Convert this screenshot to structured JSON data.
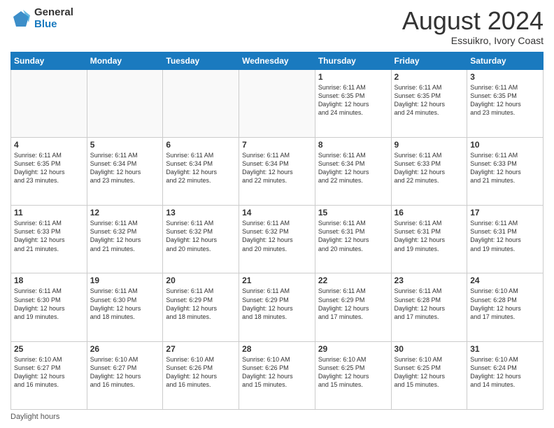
{
  "logo": {
    "general": "General",
    "blue": "Blue"
  },
  "header": {
    "month": "August 2024",
    "location": "Essuikro, Ivory Coast"
  },
  "days_of_week": [
    "Sunday",
    "Monday",
    "Tuesday",
    "Wednesday",
    "Thursday",
    "Friday",
    "Saturday"
  ],
  "footer": {
    "label": "Daylight hours"
  },
  "weeks": [
    [
      {
        "day": "",
        "info": ""
      },
      {
        "day": "",
        "info": ""
      },
      {
        "day": "",
        "info": ""
      },
      {
        "day": "",
        "info": ""
      },
      {
        "day": "1",
        "info": "Sunrise: 6:11 AM\nSunset: 6:35 PM\nDaylight: 12 hours\nand 24 minutes."
      },
      {
        "day": "2",
        "info": "Sunrise: 6:11 AM\nSunset: 6:35 PM\nDaylight: 12 hours\nand 24 minutes."
      },
      {
        "day": "3",
        "info": "Sunrise: 6:11 AM\nSunset: 6:35 PM\nDaylight: 12 hours\nand 23 minutes."
      }
    ],
    [
      {
        "day": "4",
        "info": "Sunrise: 6:11 AM\nSunset: 6:35 PM\nDaylight: 12 hours\nand 23 minutes."
      },
      {
        "day": "5",
        "info": "Sunrise: 6:11 AM\nSunset: 6:34 PM\nDaylight: 12 hours\nand 23 minutes."
      },
      {
        "day": "6",
        "info": "Sunrise: 6:11 AM\nSunset: 6:34 PM\nDaylight: 12 hours\nand 22 minutes."
      },
      {
        "day": "7",
        "info": "Sunrise: 6:11 AM\nSunset: 6:34 PM\nDaylight: 12 hours\nand 22 minutes."
      },
      {
        "day": "8",
        "info": "Sunrise: 6:11 AM\nSunset: 6:34 PM\nDaylight: 12 hours\nand 22 minutes."
      },
      {
        "day": "9",
        "info": "Sunrise: 6:11 AM\nSunset: 6:33 PM\nDaylight: 12 hours\nand 22 minutes."
      },
      {
        "day": "10",
        "info": "Sunrise: 6:11 AM\nSunset: 6:33 PM\nDaylight: 12 hours\nand 21 minutes."
      }
    ],
    [
      {
        "day": "11",
        "info": "Sunrise: 6:11 AM\nSunset: 6:33 PM\nDaylight: 12 hours\nand 21 minutes."
      },
      {
        "day": "12",
        "info": "Sunrise: 6:11 AM\nSunset: 6:32 PM\nDaylight: 12 hours\nand 21 minutes."
      },
      {
        "day": "13",
        "info": "Sunrise: 6:11 AM\nSunset: 6:32 PM\nDaylight: 12 hours\nand 20 minutes."
      },
      {
        "day": "14",
        "info": "Sunrise: 6:11 AM\nSunset: 6:32 PM\nDaylight: 12 hours\nand 20 minutes."
      },
      {
        "day": "15",
        "info": "Sunrise: 6:11 AM\nSunset: 6:31 PM\nDaylight: 12 hours\nand 20 minutes."
      },
      {
        "day": "16",
        "info": "Sunrise: 6:11 AM\nSunset: 6:31 PM\nDaylight: 12 hours\nand 19 minutes."
      },
      {
        "day": "17",
        "info": "Sunrise: 6:11 AM\nSunset: 6:31 PM\nDaylight: 12 hours\nand 19 minutes."
      }
    ],
    [
      {
        "day": "18",
        "info": "Sunrise: 6:11 AM\nSunset: 6:30 PM\nDaylight: 12 hours\nand 19 minutes."
      },
      {
        "day": "19",
        "info": "Sunrise: 6:11 AM\nSunset: 6:30 PM\nDaylight: 12 hours\nand 18 minutes."
      },
      {
        "day": "20",
        "info": "Sunrise: 6:11 AM\nSunset: 6:29 PM\nDaylight: 12 hours\nand 18 minutes."
      },
      {
        "day": "21",
        "info": "Sunrise: 6:11 AM\nSunset: 6:29 PM\nDaylight: 12 hours\nand 18 minutes."
      },
      {
        "day": "22",
        "info": "Sunrise: 6:11 AM\nSunset: 6:29 PM\nDaylight: 12 hours\nand 17 minutes."
      },
      {
        "day": "23",
        "info": "Sunrise: 6:11 AM\nSunset: 6:28 PM\nDaylight: 12 hours\nand 17 minutes."
      },
      {
        "day": "24",
        "info": "Sunrise: 6:10 AM\nSunset: 6:28 PM\nDaylight: 12 hours\nand 17 minutes."
      }
    ],
    [
      {
        "day": "25",
        "info": "Sunrise: 6:10 AM\nSunset: 6:27 PM\nDaylight: 12 hours\nand 16 minutes."
      },
      {
        "day": "26",
        "info": "Sunrise: 6:10 AM\nSunset: 6:27 PM\nDaylight: 12 hours\nand 16 minutes."
      },
      {
        "day": "27",
        "info": "Sunrise: 6:10 AM\nSunset: 6:26 PM\nDaylight: 12 hours\nand 16 minutes."
      },
      {
        "day": "28",
        "info": "Sunrise: 6:10 AM\nSunset: 6:26 PM\nDaylight: 12 hours\nand 15 minutes."
      },
      {
        "day": "29",
        "info": "Sunrise: 6:10 AM\nSunset: 6:25 PM\nDaylight: 12 hours\nand 15 minutes."
      },
      {
        "day": "30",
        "info": "Sunrise: 6:10 AM\nSunset: 6:25 PM\nDaylight: 12 hours\nand 15 minutes."
      },
      {
        "day": "31",
        "info": "Sunrise: 6:10 AM\nSunset: 6:24 PM\nDaylight: 12 hours\nand 14 minutes."
      }
    ]
  ]
}
